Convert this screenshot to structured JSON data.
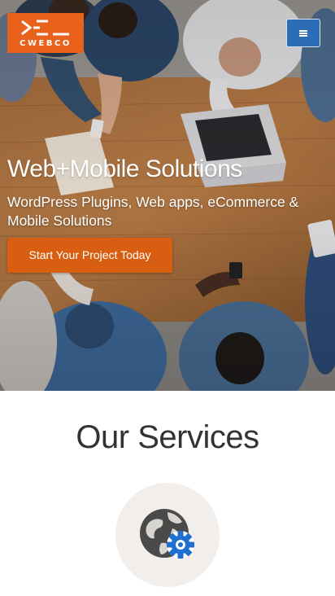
{
  "header": {
    "logo_text": "CWEBCO",
    "logo_icon": "cwebco-logo-mark",
    "menu_icon": "hamburger-menu-icon",
    "brand_color": "#e8621c",
    "menu_color": "#2d6db7"
  },
  "hero": {
    "title": "Web+Mobile Solutions",
    "subtitle": "WordPress Plugins, Web apps, eCommerce & Mobile Solutions",
    "cta_label": "Start Your Project Today",
    "cta_color": "#d85f12"
  },
  "services": {
    "title": "Our Services",
    "items": [
      {
        "icon": "globe-gear-icon"
      }
    ]
  }
}
